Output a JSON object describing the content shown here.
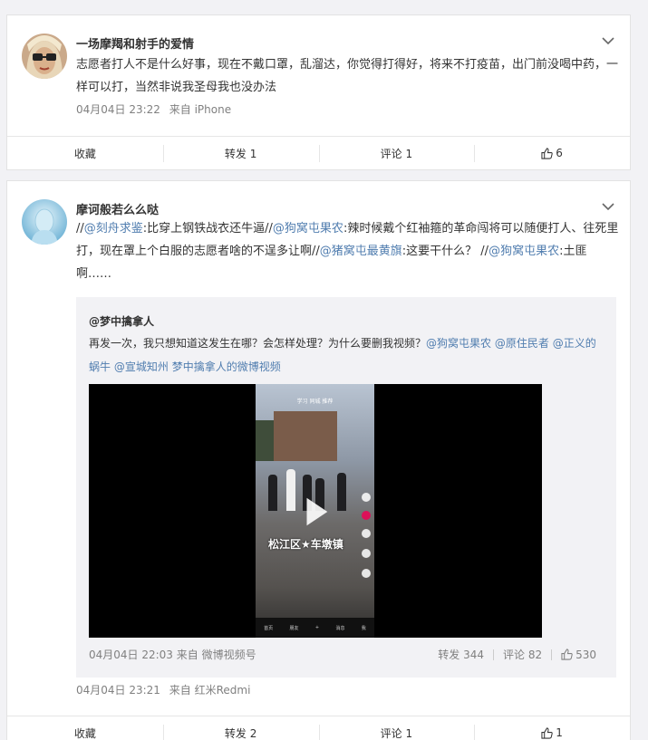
{
  "posts": [
    {
      "username": "一场摩羯和射手的爱情",
      "text": "志愿者打人不是什么好事，现在不戴口罩，乱溜达，你觉得打得好，将来不打疫苗，出门前没喝中药，一样可以打，当然非说我圣母我也没办法",
      "time": "04月04日 23:22",
      "source": "来自 iPhone",
      "actions": {
        "favorite": "收藏",
        "repost": "转发 1",
        "comment": "评论 1",
        "like": "6"
      }
    },
    {
      "username": "摩诃般若么么哒",
      "text_parts": [
        {
          "t": "//",
          "link": false
        },
        {
          "t": "@刻舟求鉴",
          "link": true
        },
        {
          "t": ":比穿上钢铁战衣还牛逼//",
          "link": false
        },
        {
          "t": "@狗窝屯果农",
          "link": true
        },
        {
          "t": ":辣时候戴个红袖箍的革命闯将可以随便打人、往死里打，现在罩上个白服的志愿者啥的不逞多让啊//",
          "link": false
        },
        {
          "t": "@猪窝屯最黄旗",
          "link": true
        },
        {
          "t": ":这要干什么？ //",
          "link": false
        },
        {
          "t": "@狗窝屯果农",
          "link": true
        },
        {
          "t": ":土匪啊……",
          "link": false
        }
      ],
      "quote": {
        "username": "@梦中擒拿人",
        "text_parts": [
          {
            "t": "再发一次，我只想知道这发生在哪？会怎样处理？为什么要删我视频？",
            "link": false
          },
          {
            "t": "@狗窝屯果农",
            "link": true
          },
          {
            "t": " ",
            "link": false
          },
          {
            "t": "@原住民者",
            "link": true
          },
          {
            "t": " ",
            "link": false
          },
          {
            "t": "@正义的蜗牛",
            "link": true
          },
          {
            "t": " ",
            "link": false
          },
          {
            "t": "@宣城知州",
            "link": true
          },
          {
            "t": " ",
            "link": false
          },
          {
            "t": "梦中擒拿人的微博视频",
            "link": true
          }
        ],
        "video": {
          "status_tabs": "学习  同城  推荐",
          "overlay_label": "松江区★车墩镇",
          "nav_items": [
            "首页",
            "朋友",
            "+",
            "消息",
            "我"
          ]
        },
        "time": "04月04日 22:03",
        "source": "来自 微博视频号",
        "repost": "转发 344",
        "comment": "评论 82",
        "like": "530"
      },
      "time": "04月04日 23:21",
      "source": "来自 红米Redmi",
      "actions": {
        "favorite": "收藏",
        "repost": "转发 2",
        "comment": "评论 1",
        "like": "1"
      }
    }
  ],
  "colors": {
    "link": "#507daf",
    "meta": "#808080",
    "background": "#f2f2f5"
  }
}
